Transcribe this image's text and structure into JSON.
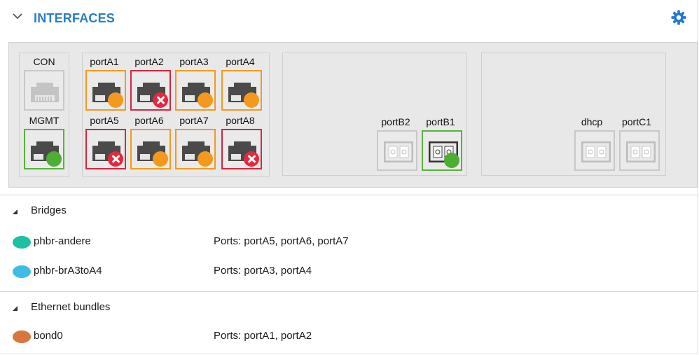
{
  "header": {
    "title": "INTERFACES",
    "chevron_icon": "chevron-down-icon",
    "settings_icon": "gear-icon"
  },
  "colors": {
    "accent": "#2a7cc7",
    "warn": "#f39a1e",
    "error": "#e8273f",
    "ok": "#4caf34"
  },
  "ports": {
    "con": {
      "label": "CON",
      "status": "disabled"
    },
    "mgmt": {
      "label": "MGMT",
      "status": "up"
    },
    "portA1": {
      "label": "portA1",
      "status": "warning"
    },
    "portA2": {
      "label": "portA2",
      "status": "error"
    },
    "portA3": {
      "label": "portA3",
      "status": "warning"
    },
    "portA4": {
      "label": "portA4",
      "status": "warning"
    },
    "portA5": {
      "label": "portA5",
      "status": "error"
    },
    "portA6": {
      "label": "portA6",
      "status": "warning"
    },
    "portA7": {
      "label": "portA7",
      "status": "warning"
    },
    "portA8": {
      "label": "portA8",
      "status": "error"
    },
    "portB2": {
      "label": "portB2",
      "status": "disabled"
    },
    "portB1": {
      "label": "portB1",
      "status": "up"
    },
    "dhcp": {
      "label": "dhcp",
      "status": "disabled"
    },
    "portC1": {
      "label": "portC1",
      "status": "disabled"
    }
  },
  "bridges": {
    "heading": "Bridges",
    "items": [
      {
        "name": "phbr-andere",
        "color": "#1fbfa3",
        "ports": "Ports:  portA5, portA6, portA7"
      },
      {
        "name": "phbr-brA3toA4",
        "color": "#3fbce6",
        "ports": "Ports:  portA3, portA4"
      }
    ]
  },
  "bundles": {
    "heading": "Ethernet bundles",
    "items": [
      {
        "name": "bond0",
        "color": "#d9763d",
        "ports": "Ports:  portA1, portA2"
      }
    ]
  }
}
